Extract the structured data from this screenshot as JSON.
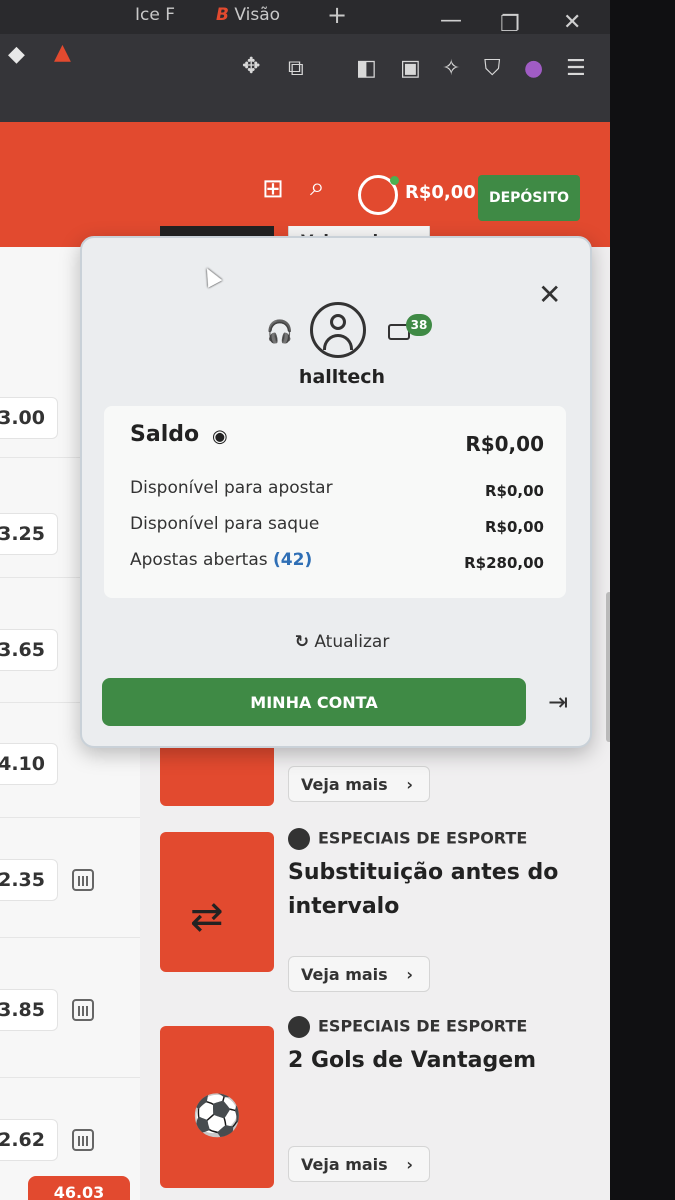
{
  "browser": {
    "tabs": [
      {
        "label": "Ice F"
      },
      {
        "label": "Visão"
      }
    ],
    "new_tab": "+"
  },
  "header": {
    "balance": "R$0,00",
    "deposit_label": "DEPÓSITO",
    "veja_top": "Veja mais"
  },
  "odds": [
    "3.00",
    "3.25",
    "3.65",
    "4.10",
    "2.35",
    "3.85",
    "2.62"
  ],
  "bottom_badge": "46.03",
  "cards": [
    {
      "veja": "Veja mais"
    },
    {
      "category": "ESPECIAIS DE ESPORTE",
      "title": "Substituição antes do intervalo",
      "veja": "Veja mais"
    },
    {
      "category": "ESPECIAIS DE ESPORTE",
      "title": "2 Gols de Vantagem",
      "veja": "Veja mais"
    }
  ],
  "panel": {
    "username": "halltech",
    "mail_count": "38",
    "saldo_label": "Saldo",
    "saldo_value": "R$0,00",
    "rows": [
      {
        "label": "Disponível para apostar",
        "value": "R$0,00"
      },
      {
        "label": "Disponível para saque",
        "value": "R$0,00"
      },
      {
        "label": "Apostas abertas",
        "count": "(42)",
        "value": "R$280,00"
      }
    ],
    "refresh_label": "Atualizar",
    "account_button": "MINHA CONTA"
  },
  "colors": {
    "brand": "#e24a2f",
    "green": "#3f8a45",
    "link_blue": "#2f6fb5"
  }
}
